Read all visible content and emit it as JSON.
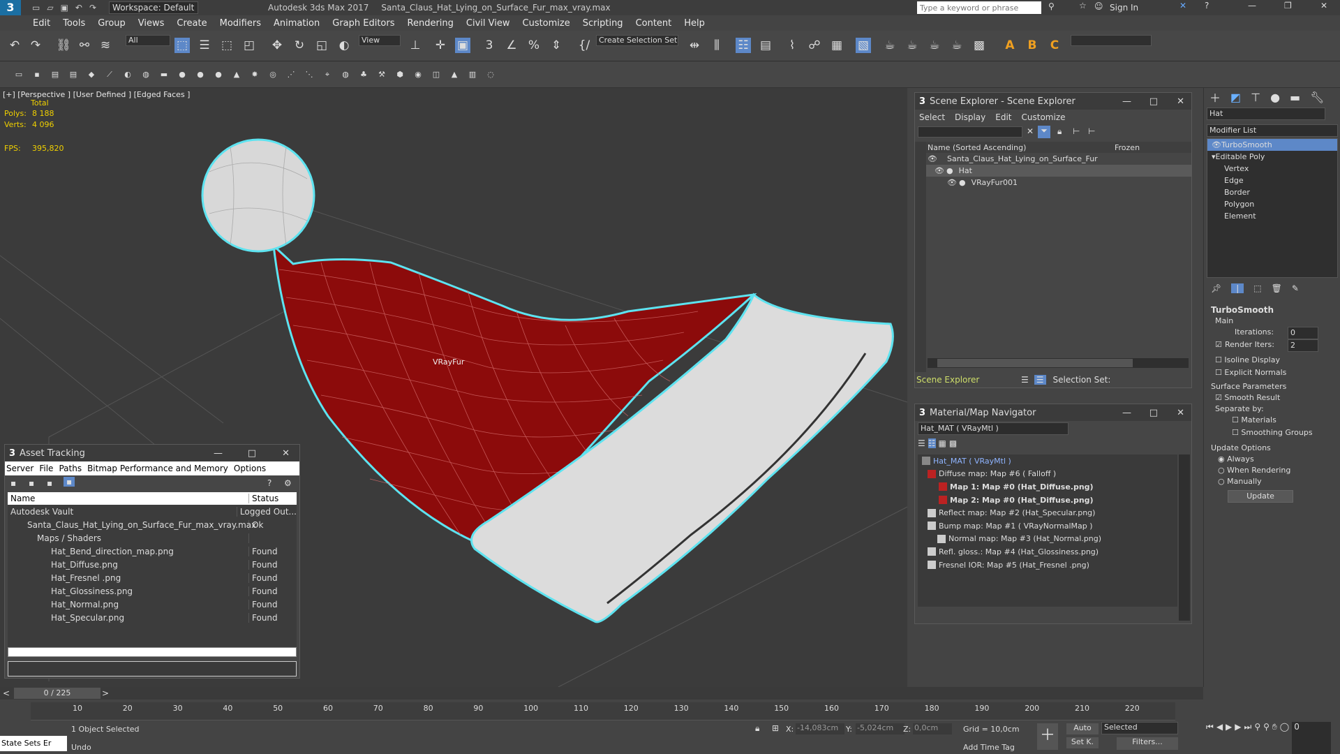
{
  "app": {
    "title": "Autodesk 3ds Max 2017",
    "file": "Santa_Claus_Hat_Lying_on_Surface_Fur_max_vray.max",
    "workspace": "Workspace: Default",
    "search_placeholder": "Type a keyword or phrase",
    "signin": "Sign In"
  },
  "menu": [
    "Edit",
    "Tools",
    "Group",
    "Views",
    "Create",
    "Modifiers",
    "Animation",
    "Graph Editors",
    "Rendering",
    "Civil View",
    "Customize",
    "Scripting",
    "Content",
    "Help"
  ],
  "toolbar": {
    "filter": "All",
    "view": "View",
    "selset": "Create Selection Set"
  },
  "viewport": {
    "label": "[+] [Perspective ] [User Defined ] [Edged Faces ]",
    "stats_total": "Total",
    "polys_label": "Polys:",
    "polys": "8 188",
    "verts_label": "Verts:",
    "verts": "4 096",
    "fps_label": "FPS:",
    "fps": "395,820",
    "obj_label": "VRayFur"
  },
  "scene_explorer": {
    "title": "Scene Explorer - Scene Explorer",
    "menu": [
      "Select",
      "Display",
      "Edit",
      "Customize"
    ],
    "col_name": "Name (Sorted Ascending)",
    "col_frozen": "Frozen",
    "items": [
      "Santa_Claus_Hat_Lying_on_Surface_Fur",
      "Hat",
      "VRayFur001"
    ],
    "footer": "Scene Explorer",
    "selset": "Selection Set:"
  },
  "modifier": {
    "search": "Hat",
    "list_label": "Modifier List",
    "stack": [
      "TurboSmooth",
      "Editable Poly",
      "Vertex",
      "Edge",
      "Border",
      "Polygon",
      "Element"
    ],
    "rollout": "TurboSmooth",
    "main": "Main",
    "iterations_label": "Iterations:",
    "iterations": "0",
    "render_iters_label": "Render Iters:",
    "render_iters": "2",
    "isoline": "Isoline Display",
    "explicit": "Explicit Normals",
    "surface": "Surface Parameters",
    "smooth": "Smooth Result",
    "separate": "Separate by:",
    "materials": "Materials",
    "smoothing": "Smoothing Groups",
    "update_options": "Update Options",
    "always": "Always",
    "when_render": "When Rendering",
    "manually": "Manually",
    "update": "Update"
  },
  "material_nav": {
    "title": "Material/Map Navigator",
    "mat": "Hat_MAT  ( VRayMtl )",
    "items": [
      "Hat_MAT  ( VRayMtl )",
      "Diffuse map: Map #6  ( Falloff )",
      "Map 1: Map #0 (Hat_Diffuse.png)",
      "Map 2: Map #0 (Hat_Diffuse.png)",
      "Reflect map: Map #2 (Hat_Specular.png)",
      "Bump map: Map #1  ( VRayNormalMap )",
      "Normal map: Map #3 (Hat_Normal.png)",
      "Refl. gloss.: Map #4 (Hat_Glossiness.png)",
      "Fresnel IOR: Map #5 (Hat_Fresnel .png)"
    ]
  },
  "asset": {
    "title": "Asset Tracking",
    "menu": [
      "Server",
      "File",
      "Paths",
      "Bitmap Performance and Memory",
      "Options"
    ],
    "col_name": "Name",
    "col_status": "Status",
    "rows": [
      {
        "name": "Autodesk Vault",
        "status": "Logged Out..."
      },
      {
        "name": "Santa_Claus_Hat_Lying_on_Surface_Fur_max_vray.max",
        "status": "Ok"
      },
      {
        "name": "Maps / Shaders",
        "status": ""
      },
      {
        "name": "Hat_Bend_direction_map.png",
        "status": "Found"
      },
      {
        "name": "Hat_Diffuse.png",
        "status": "Found"
      },
      {
        "name": "Hat_Fresnel .png",
        "status": "Found"
      },
      {
        "name": "Hat_Glossiness.png",
        "status": "Found"
      },
      {
        "name": "Hat_Normal.png",
        "status": "Found"
      },
      {
        "name": "Hat_Specular.png",
        "status": "Found"
      }
    ]
  },
  "timeline": {
    "frame": "0 / 225",
    "ticks": [
      "10",
      "20",
      "30",
      "40",
      "50",
      "60",
      "70",
      "80",
      "90",
      "100",
      "110",
      "120",
      "130",
      "140",
      "150",
      "160",
      "170",
      "180",
      "190",
      "200",
      "210",
      "220"
    ]
  },
  "status": {
    "selected": "1 Object Selected",
    "undo": "Undo",
    "state_sets": "State Sets Er",
    "x_label": "X:",
    "x": "-14,083cm",
    "y_label": "Y:",
    "y": "-5,024cm",
    "z_label": "Z:",
    "z": "0,0cm",
    "grid": "Grid = 10,0cm",
    "add_time_tag": "Add Time Tag",
    "auto": "Auto",
    "setk": "Set K.",
    "selected_dd": "Selected",
    "filters": "Filters...",
    "frame": "0"
  }
}
